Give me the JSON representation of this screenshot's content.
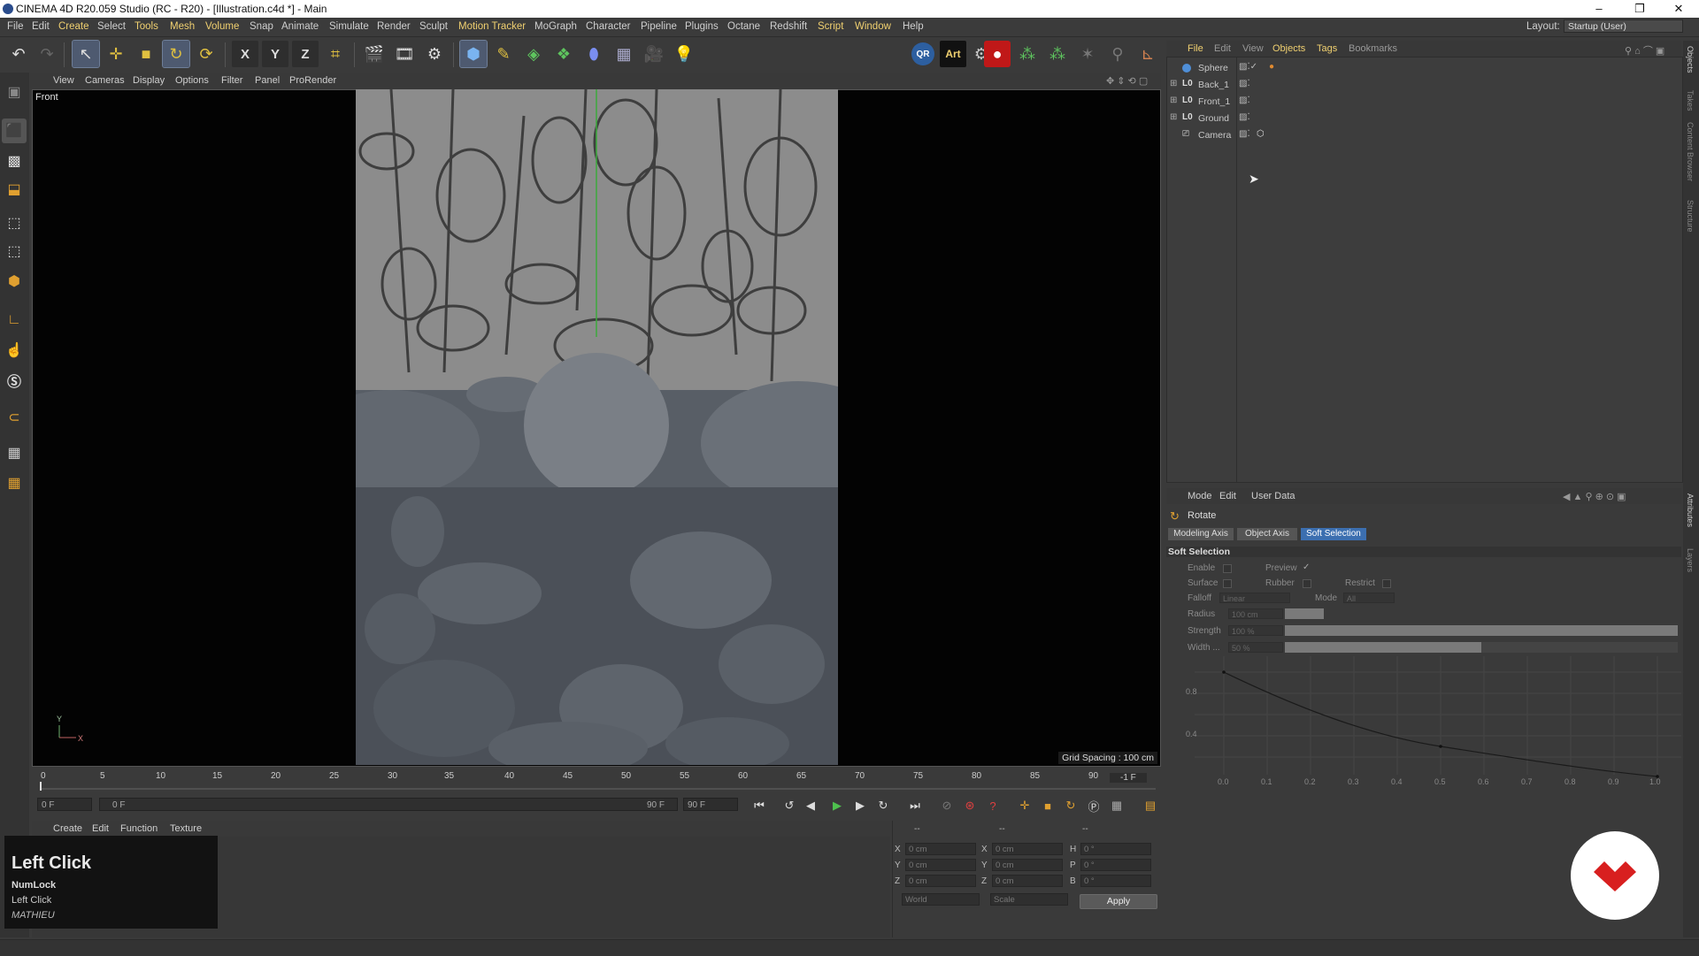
{
  "window": {
    "title": "CINEMA 4D R20.059 Studio (RC - R20) - [Illustration.c4d *] - Main",
    "controls": [
      "–",
      "❐",
      "✕"
    ]
  },
  "menubar": {
    "items": [
      "File",
      "Edit",
      "Create",
      "Select",
      "Tools",
      "Mesh",
      "Volume",
      "Snap",
      "Animate",
      "Simulate",
      "Render",
      "Sculpt",
      "Motion Tracker",
      "MoGraph",
      "Character",
      "Pipeline",
      "Plugins",
      "Octane",
      "Redshift",
      "Script",
      "Window",
      "Help"
    ],
    "highlighted": [
      "Create",
      "Tools",
      "Mesh",
      "Volume",
      "Motion Tracker",
      "Script",
      "Window"
    ],
    "layout_label": "Layout:",
    "layout_value": "Startup (User)"
  },
  "toolbar": {
    "axis_buttons": [
      "X",
      "Y",
      "Z"
    ],
    "badges": [
      "QR",
      "Art"
    ]
  },
  "viewport": {
    "menu": [
      "View",
      "Cameras",
      "Display",
      "Options",
      "Filter",
      "Panel",
      "ProRender"
    ],
    "name": "Front",
    "grid_spacing": "Grid Spacing : 100 cm",
    "axis_y": "Y",
    "axis_x": "X"
  },
  "timeline": {
    "ticks": [
      "0",
      "5",
      "10",
      "15",
      "20",
      "25",
      "30",
      "35",
      "40",
      "45",
      "50",
      "55",
      "60",
      "65",
      "70",
      "75",
      "80",
      "85",
      "90"
    ],
    "current_frame_label": "-1 F",
    "start_field": "0 F",
    "range_start": "0 F",
    "range_end": "90 F",
    "end_field": "90 F"
  },
  "material_manager": {
    "menu": [
      "Create",
      "Edit",
      "Function",
      "Texture"
    ]
  },
  "coordinates": {
    "headers": [
      "--",
      "--",
      "--"
    ],
    "rows": [
      {
        "axis": "X",
        "pos": "0 cm",
        "size_axis": "X",
        "size": "0 cm",
        "rot_axis": "H",
        "rot": "0 °"
      },
      {
        "axis": "Y",
        "pos": "0 cm",
        "size_axis": "Y",
        "size": "0 cm",
        "rot_axis": "P",
        "rot": "0 °"
      },
      {
        "axis": "Z",
        "pos": "0 cm",
        "size_axis": "Z",
        "size": "0 cm",
        "rot_axis": "B",
        "rot": "0 °"
      }
    ],
    "mode_world": "World",
    "mode_scale": "Scale",
    "apply": "Apply"
  },
  "key_overlay": {
    "title": "Left Click",
    "line1": "NumLock",
    "line2": "Left Click",
    "line3": "MATHIEU"
  },
  "object_manager": {
    "menu": [
      "File",
      "Edit",
      "View",
      "Objects",
      "Tags",
      "Bookmarks"
    ],
    "objects": [
      {
        "name": "Sphere",
        "icon": "sphere-icon"
      },
      {
        "name": "Back_1",
        "icon": "layer-icon"
      },
      {
        "name": "Front_1",
        "icon": "layer-icon"
      },
      {
        "name": "Ground",
        "icon": "layer-icon"
      },
      {
        "name": "Camera",
        "icon": "camera-icon"
      }
    ]
  },
  "attribute_manager": {
    "menu": [
      "Mode",
      "Edit",
      "User Data"
    ],
    "tool_name": "Rotate",
    "tabs": [
      "Modeling Axis",
      "Object Axis",
      "Soft Selection"
    ],
    "active_tab": "Soft Selection",
    "section": "Soft Selection",
    "enable_label": "Enable",
    "preview_label": "Preview",
    "preview_check": "✓",
    "surface_label": "Surface",
    "rubber_label": "Rubber",
    "restrict_label": "Restrict",
    "falloff_label": "Falloff",
    "falloff_value": "Linear",
    "mode_label": "Mode",
    "mode_value": "All",
    "radius_label": "Radius",
    "radius_value": "100 cm",
    "strength_label": "Strength",
    "strength_value": "100 %",
    "width_label": "Width ...",
    "width_value": "50 %",
    "graph_y_labels": [
      "0.8",
      "0.4"
    ],
    "graph_x_labels": [
      "0.0",
      "0.1",
      "0.2",
      "0.3",
      "0.4",
      "0.5",
      "0.6",
      "0.7",
      "0.8",
      "0.9",
      "1.0"
    ]
  },
  "right_strip_tabs": [
    "Objects",
    "Takes",
    "Content Browser",
    "Structure",
    "Attributes",
    "Layers"
  ],
  "colors": {
    "accent_yellow": "#f0d070",
    "selection_blue": "#3c6fb0",
    "logo_red": "#d81f1f"
  }
}
